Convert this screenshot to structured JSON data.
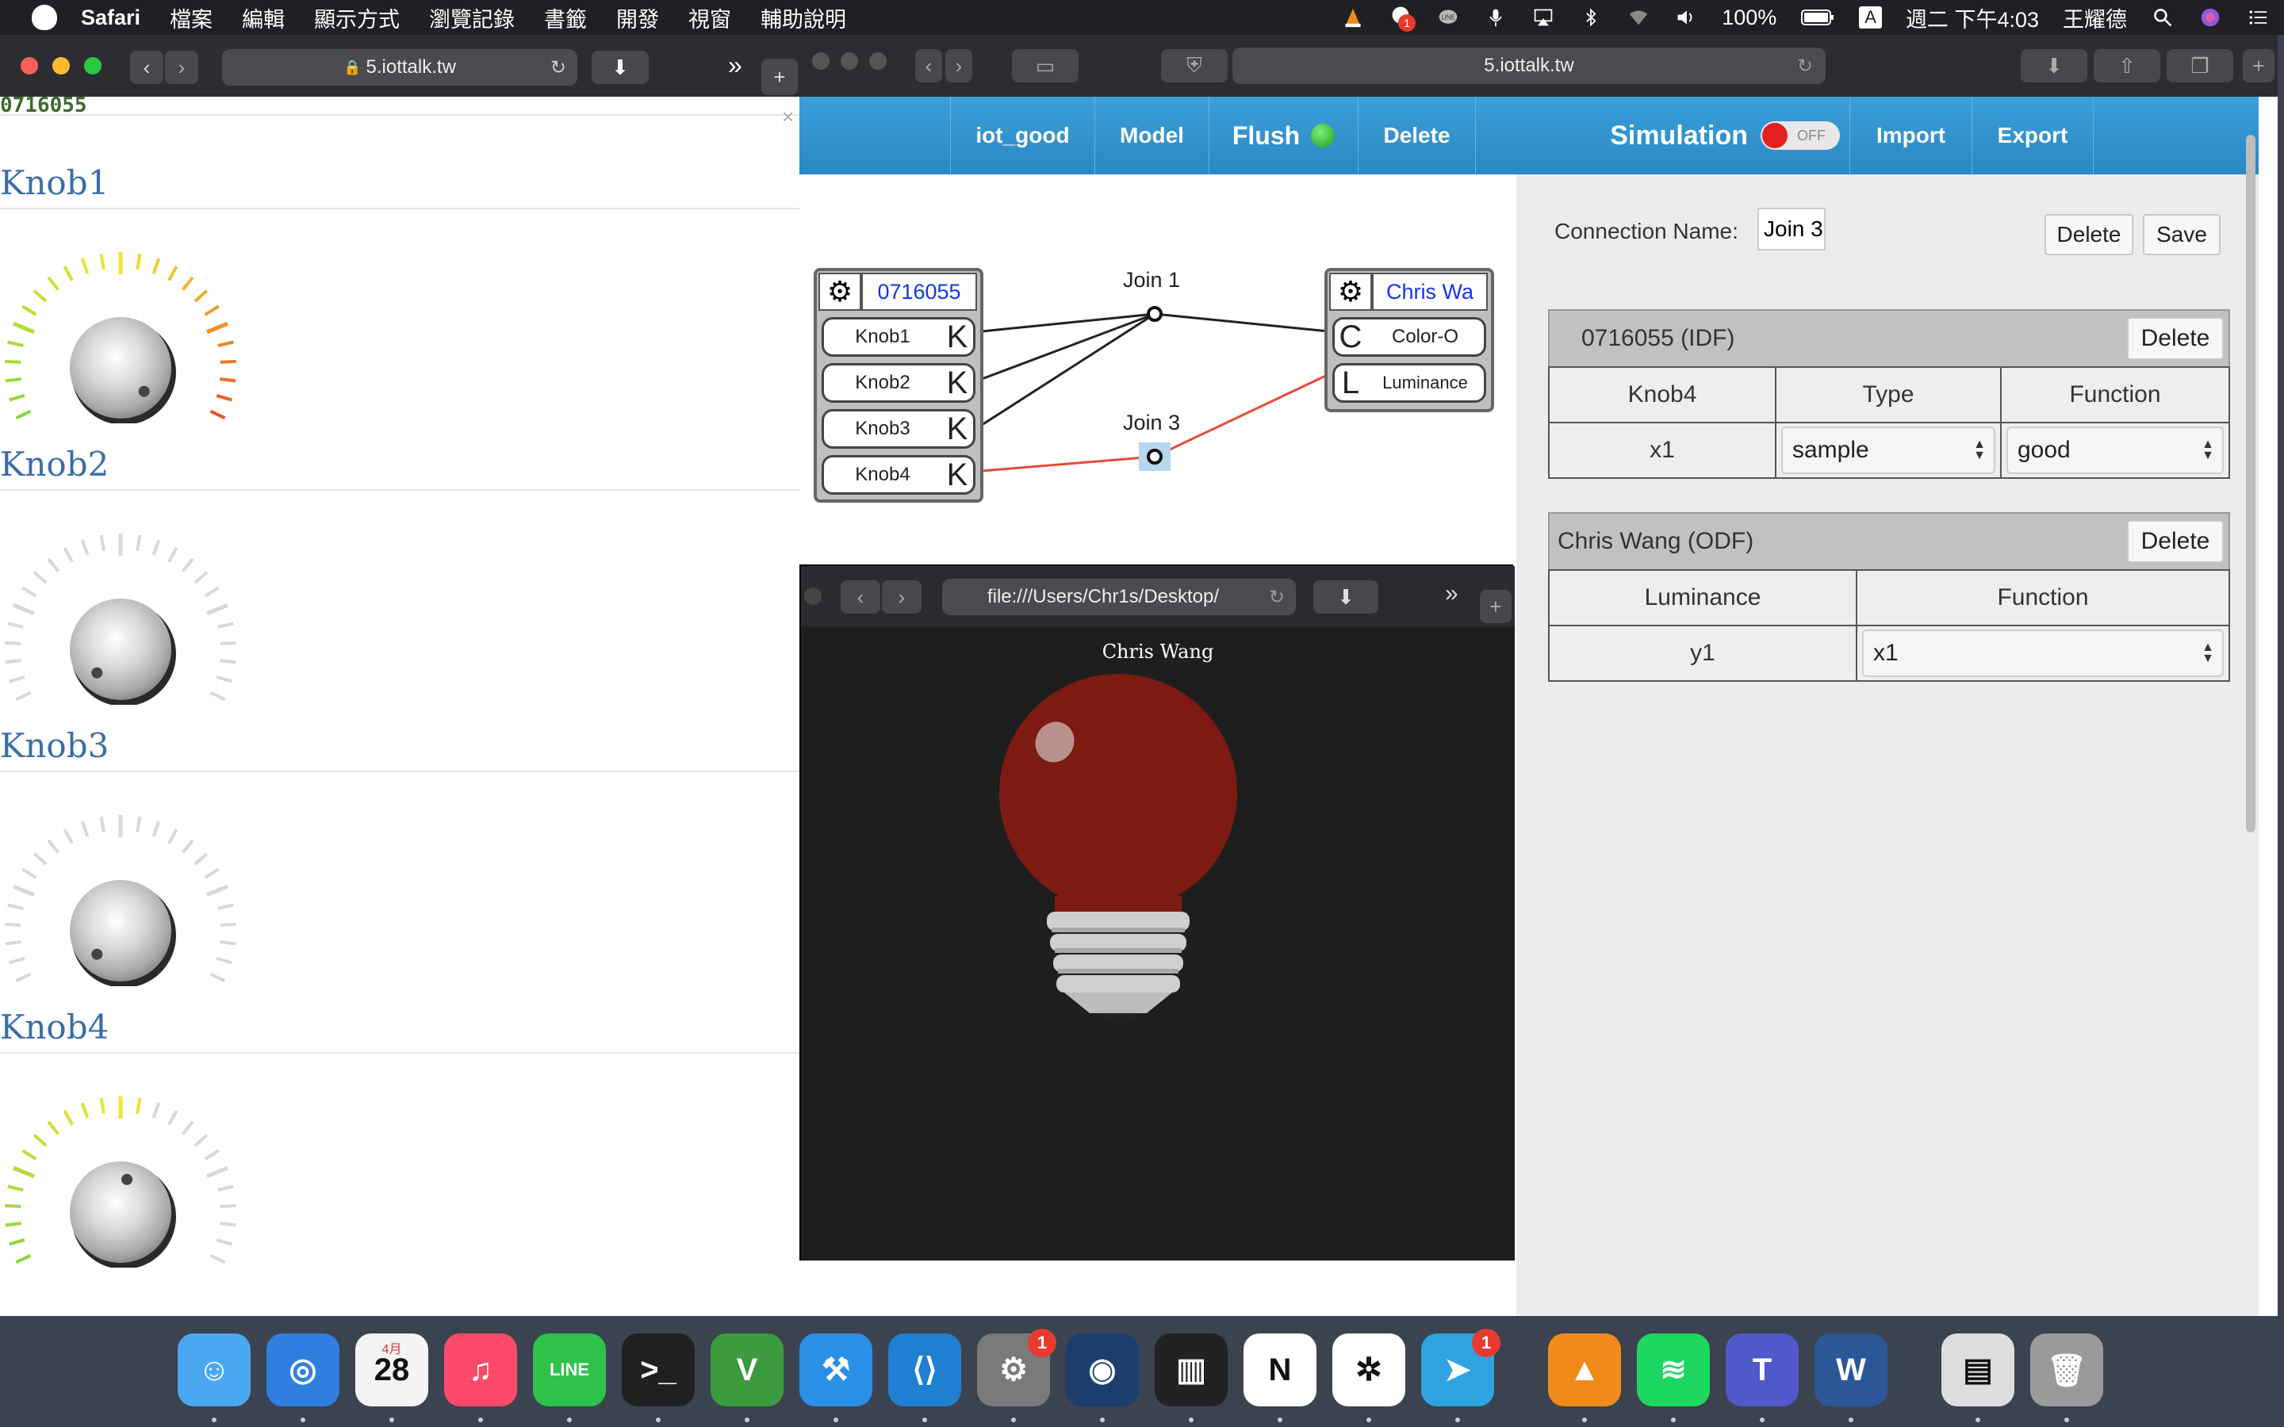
{
  "menubar": {
    "app": "Safari",
    "items": [
      "檔案",
      "編輯",
      "顯示方式",
      "瀏覽記錄",
      "書籤",
      "開發",
      "視窗",
      "輔助說明"
    ],
    "battery": "100%",
    "input_method": "A",
    "datetime": "週二 下午4:03",
    "user": "王耀德",
    "notification_badge": "1"
  },
  "left_window": {
    "url": "5.iottalk.tw",
    "device_id": "0716055",
    "close_glyph": "×",
    "knobs": [
      {
        "name": "Knob1",
        "value": "1.000",
        "level": 1.0,
        "min": "0.0",
        "max": "1.0"
      },
      {
        "name": "Knob2",
        "value": "0.000",
        "level": 0.0,
        "min": "0.0",
        "max": "1.0"
      },
      {
        "name": "Knob3",
        "value": "0.000",
        "level": 0.0,
        "min": "0.0",
        "max": "1.0"
      },
      {
        "name": "Knob4",
        "value": "0.541",
        "level": 0.541,
        "min": "0.0",
        "max": "1.0"
      }
    ]
  },
  "main_window": {
    "url": "5.iottalk.tw",
    "nav": {
      "project": "iot_good",
      "model": "Model",
      "flush": "Flush",
      "delete": "Delete",
      "simulation": "Simulation",
      "simulation_state": "OFF",
      "import": "Import",
      "export": "Export"
    },
    "canvas": {
      "idf_device": {
        "name": "0716055",
        "features": [
          {
            "label": "Knob1",
            "letter": "K"
          },
          {
            "label": "Knob2",
            "letter": "K"
          },
          {
            "label": "Knob3",
            "letter": "K"
          },
          {
            "label": "Knob4",
            "letter": "K"
          }
        ]
      },
      "odf_device": {
        "name": "Chris Wa",
        "features": [
          {
            "label": "Color-O",
            "letter": "C"
          },
          {
            "label": "Luminance",
            "letter": "L"
          }
        ]
      },
      "joins": [
        "Join 1",
        "Join 3"
      ]
    },
    "panel": {
      "connection_label": "Connection Name:",
      "connection_name": "Join 3",
      "delete_btn": "Delete",
      "save_btn": "Save",
      "idf_table": {
        "title": "0716055 (IDF)",
        "delete": "Delete",
        "headers": [
          "Knob4",
          "Type",
          "Function"
        ],
        "row": {
          "var": "x1",
          "type": "sample",
          "function": "good"
        }
      },
      "odf_table": {
        "title": "Chris Wang (ODF)",
        "delete": "Delete",
        "headers": [
          "Luminance",
          "Function"
        ],
        "row": {
          "var": "y1",
          "function": "x1"
        }
      }
    },
    "bulb_window": {
      "url": "file:///Users/Chr1s/Desktop/",
      "title": "Chris Wang",
      "color": "#7d1a12"
    }
  },
  "dock": {
    "apps": [
      {
        "name": "Finder",
        "color": "#4aa8f0",
        "glyph": "☺"
      },
      {
        "name": "Safari",
        "color": "#2f7fe0",
        "glyph": "◎"
      },
      {
        "name": "Calendar",
        "color": "#f4f4f4",
        "glyph": "28",
        "month": "4月"
      },
      {
        "name": "Music",
        "color": "#fb4a6a",
        "glyph": "♫"
      },
      {
        "name": "LINE",
        "color": "#2fc24b",
        "glyph": "LINE"
      },
      {
        "name": "Terminal",
        "color": "#202020",
        "glyph": ">_"
      },
      {
        "name": "Vim",
        "color": "#3c9b3c",
        "glyph": "V"
      },
      {
        "name": "Xcode",
        "color": "#2a8fe6",
        "glyph": "⚒"
      },
      {
        "name": "VS Code",
        "color": "#1f7fd0",
        "glyph": "⟨⟩"
      },
      {
        "name": "System Preferences",
        "color": "#7a7a7a",
        "glyph": "⚙",
        "badge": "1"
      },
      {
        "name": "Audio",
        "color": "#1b3e6e",
        "glyph": "◉"
      },
      {
        "name": "Piano",
        "color": "#222",
        "glyph": "▥"
      },
      {
        "name": "Notion",
        "color": "#fff",
        "glyph": "N"
      },
      {
        "name": "Slack",
        "color": "#fff",
        "glyph": "✲"
      },
      {
        "name": "Telegram",
        "color": "#2fa3e0",
        "glyph": "➤",
        "badge": "1"
      },
      {
        "name": "VLC",
        "color": "#f08a1a",
        "glyph": "▲"
      },
      {
        "name": "Spotify",
        "color": "#1ed760",
        "glyph": "≋"
      },
      {
        "name": "Teams",
        "color": "#5059c9",
        "glyph": "T"
      },
      {
        "name": "Word",
        "color": "#2b5797",
        "glyph": "W"
      },
      {
        "name": "Preview",
        "color": "#dddddd",
        "glyph": "▤"
      },
      {
        "name": "Trash",
        "color": "#9a9a9a",
        "glyph": "🗑"
      }
    ]
  }
}
